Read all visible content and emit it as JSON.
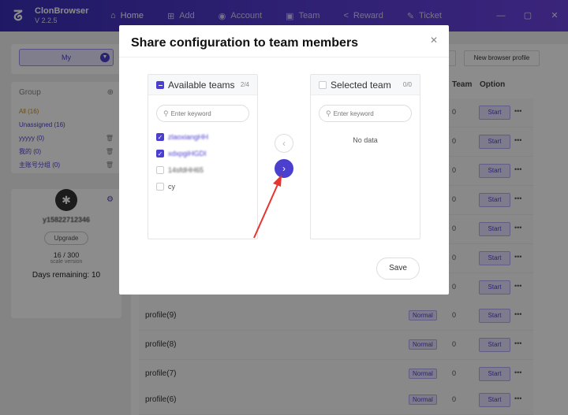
{
  "app": {
    "name": "ClonBrowser",
    "version": "V 2.2.5"
  },
  "nav": [
    {
      "icon": "⌂",
      "label": "Home"
    },
    {
      "icon": "⊞",
      "label": "Add"
    },
    {
      "icon": "◉",
      "label": "Account"
    },
    {
      "icon": "▣",
      "label": "Team"
    },
    {
      "icon": "<",
      "label": "Reward"
    },
    {
      "icon": "✎",
      "label": "Ticket"
    }
  ],
  "window_controls": {
    "minimize": "—",
    "maximize": "▢",
    "close": "✕"
  },
  "left": {
    "my_select": "My",
    "group_title": "Group",
    "groups": [
      {
        "label": "All  (16)"
      },
      {
        "label": "Unassigned  (16)"
      },
      {
        "label": "yyyyy  (0)"
      },
      {
        "label": "我的  (0)"
      },
      {
        "label": "主账号分组  (0)"
      }
    ],
    "username": "y15822712346",
    "upgrade": "Upgrade",
    "count": "16 / 300",
    "scale": "scale version",
    "days_remaining": "Days remaining: 10"
  },
  "main": {
    "new_profile_button": "New browser profile",
    "columns": {
      "team": "Team",
      "option": "Option"
    },
    "rows": [
      {
        "name": "profile(9)",
        "status": "Normal",
        "team": "0",
        "start": "Start",
        "more": "•••"
      },
      {
        "name": "profile(8)",
        "status": "Normal",
        "team": "0",
        "start": "Start",
        "more": "•••"
      },
      {
        "name": "profile(7)",
        "status": "Normal",
        "team": "0",
        "start": "Start",
        "more": "•••"
      },
      {
        "name": "profile(6)",
        "status": "Normal",
        "team": "0",
        "start": "Start",
        "more": "•••"
      }
    ],
    "upper_rows": [
      {
        "team": "0",
        "start": "Start",
        "more": "•••"
      },
      {
        "team": "0",
        "start": "Start",
        "more": "•••"
      },
      {
        "team": "0",
        "start": "Start",
        "more": "•••"
      },
      {
        "team": "0",
        "start": "Start",
        "more": "•••"
      },
      {
        "team": "0",
        "start": "Start",
        "more": "•••"
      },
      {
        "team": "0",
        "start": "Start",
        "more": "•••"
      },
      {
        "team": "0",
        "start": "Start",
        "more": "•••"
      }
    ]
  },
  "modal": {
    "title": "Share configuration to team members",
    "close": "✕",
    "available": {
      "title": "Available teams",
      "count": "2/4",
      "search_placeholder": "Enter keyword",
      "items": [
        {
          "label": "zlaoxiangHH",
          "checked": true
        },
        {
          "label": "xdxpgiHGDI",
          "checked": true
        },
        {
          "label": "14sfdHH65",
          "checked": false
        },
        {
          "label": "cy",
          "checked": false
        }
      ]
    },
    "selected": {
      "title": "Selected team",
      "count": "0/0",
      "search_placeholder": "Enter keyword",
      "empty": "No data"
    },
    "move_left": "‹",
    "move_right": "›",
    "save": "Save"
  },
  "colors": {
    "accent": "#4b3fcf",
    "titlebar": "#4a35c8",
    "annotation_arrow": "#e8332f"
  }
}
